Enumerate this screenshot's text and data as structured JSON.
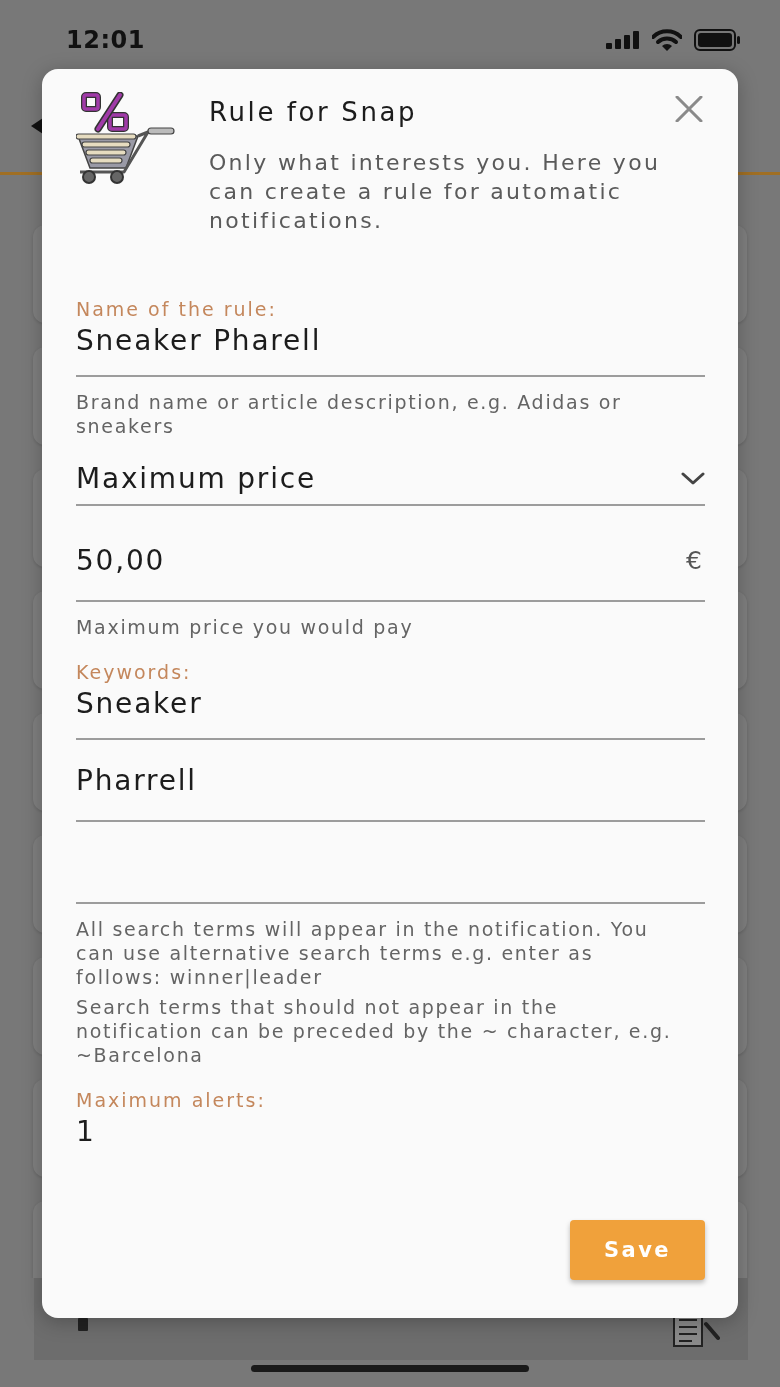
{
  "status_bar": {
    "time": "12:01"
  },
  "dialog": {
    "title": "Rule for Snap",
    "description": "Only what interests you. Here you can create a rule for automatic notifications.",
    "fields": [
      {
        "kind": "text",
        "label": "Name of the rule:",
        "value": "Sneaker Pharell",
        "helpers": [
          "Brand name or article description, e.g. Adidas or sneakers"
        ]
      },
      {
        "kind": "select",
        "value": "Maximum price"
      },
      {
        "kind": "text",
        "value": "50,00",
        "suffix": "€",
        "helpers": [
          "Maximum price you would pay"
        ]
      },
      {
        "kind": "text",
        "label": "Keywords:",
        "value": "Sneaker"
      },
      {
        "kind": "text",
        "value": "Pharrell"
      },
      {
        "kind": "text",
        "helpers": [
          "All search terms will appear in the notification. You can use alternative search terms e.g. enter as follows: winner|leader",
          "Search terms that should not appear in the notification can be preceded by the ~ character, e.g. ~Barcelona"
        ]
      },
      {
        "kind": "plain",
        "label": "Maximum alerts:",
        "value": "1"
      }
    ],
    "save_button": {
      "label": "Save"
    }
  }
}
